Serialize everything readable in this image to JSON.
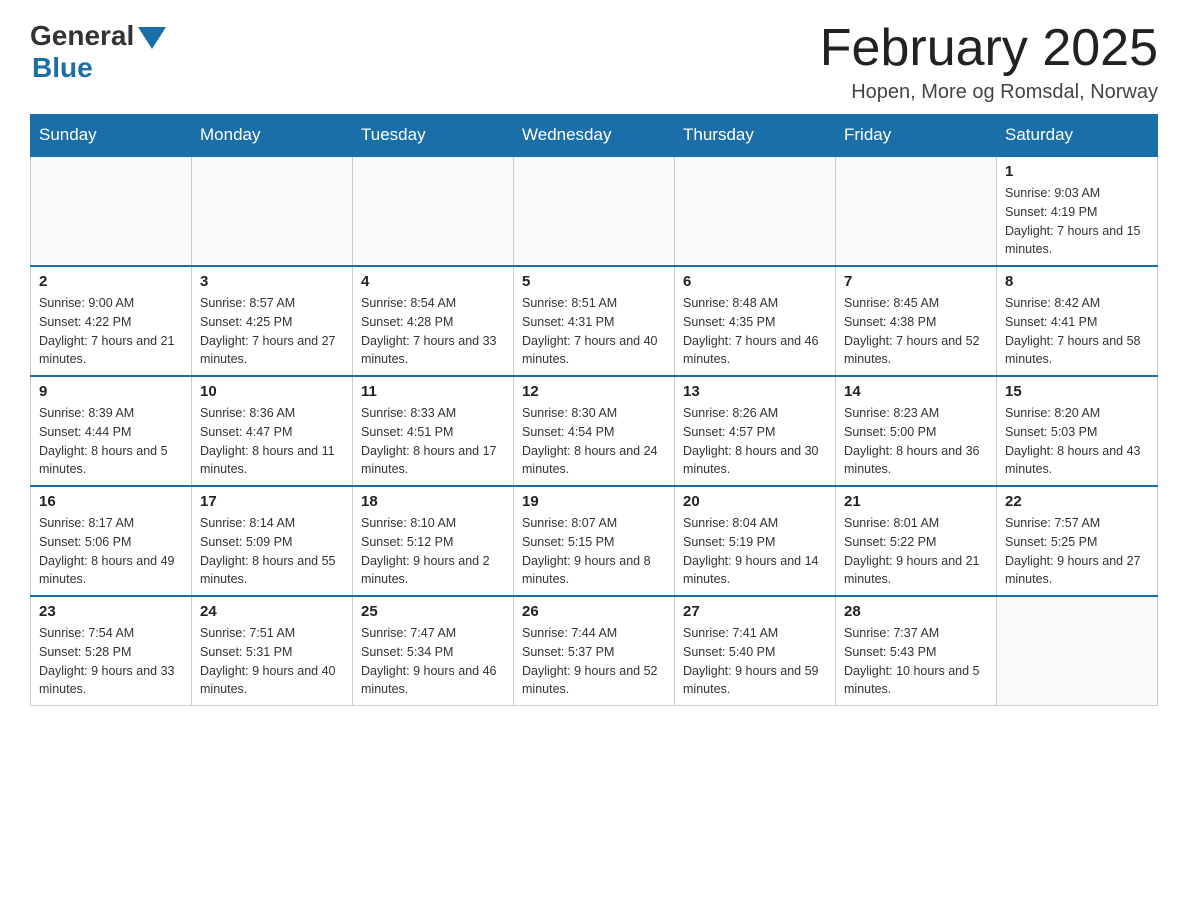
{
  "header": {
    "logo_general": "General",
    "logo_blue": "Blue",
    "month_title": "February 2025",
    "location": "Hopen, More og Romsdal, Norway"
  },
  "days_of_week": [
    "Sunday",
    "Monday",
    "Tuesday",
    "Wednesday",
    "Thursday",
    "Friday",
    "Saturday"
  ],
  "weeks": [
    [
      {
        "day": "",
        "info": ""
      },
      {
        "day": "",
        "info": ""
      },
      {
        "day": "",
        "info": ""
      },
      {
        "day": "",
        "info": ""
      },
      {
        "day": "",
        "info": ""
      },
      {
        "day": "",
        "info": ""
      },
      {
        "day": "1",
        "info": "Sunrise: 9:03 AM\nSunset: 4:19 PM\nDaylight: 7 hours and 15 minutes."
      }
    ],
    [
      {
        "day": "2",
        "info": "Sunrise: 9:00 AM\nSunset: 4:22 PM\nDaylight: 7 hours and 21 minutes."
      },
      {
        "day": "3",
        "info": "Sunrise: 8:57 AM\nSunset: 4:25 PM\nDaylight: 7 hours and 27 minutes."
      },
      {
        "day": "4",
        "info": "Sunrise: 8:54 AM\nSunset: 4:28 PM\nDaylight: 7 hours and 33 minutes."
      },
      {
        "day": "5",
        "info": "Sunrise: 8:51 AM\nSunset: 4:31 PM\nDaylight: 7 hours and 40 minutes."
      },
      {
        "day": "6",
        "info": "Sunrise: 8:48 AM\nSunset: 4:35 PM\nDaylight: 7 hours and 46 minutes."
      },
      {
        "day": "7",
        "info": "Sunrise: 8:45 AM\nSunset: 4:38 PM\nDaylight: 7 hours and 52 minutes."
      },
      {
        "day": "8",
        "info": "Sunrise: 8:42 AM\nSunset: 4:41 PM\nDaylight: 7 hours and 58 minutes."
      }
    ],
    [
      {
        "day": "9",
        "info": "Sunrise: 8:39 AM\nSunset: 4:44 PM\nDaylight: 8 hours and 5 minutes."
      },
      {
        "day": "10",
        "info": "Sunrise: 8:36 AM\nSunset: 4:47 PM\nDaylight: 8 hours and 11 minutes."
      },
      {
        "day": "11",
        "info": "Sunrise: 8:33 AM\nSunset: 4:51 PM\nDaylight: 8 hours and 17 minutes."
      },
      {
        "day": "12",
        "info": "Sunrise: 8:30 AM\nSunset: 4:54 PM\nDaylight: 8 hours and 24 minutes."
      },
      {
        "day": "13",
        "info": "Sunrise: 8:26 AM\nSunset: 4:57 PM\nDaylight: 8 hours and 30 minutes."
      },
      {
        "day": "14",
        "info": "Sunrise: 8:23 AM\nSunset: 5:00 PM\nDaylight: 8 hours and 36 minutes."
      },
      {
        "day": "15",
        "info": "Sunrise: 8:20 AM\nSunset: 5:03 PM\nDaylight: 8 hours and 43 minutes."
      }
    ],
    [
      {
        "day": "16",
        "info": "Sunrise: 8:17 AM\nSunset: 5:06 PM\nDaylight: 8 hours and 49 minutes."
      },
      {
        "day": "17",
        "info": "Sunrise: 8:14 AM\nSunset: 5:09 PM\nDaylight: 8 hours and 55 minutes."
      },
      {
        "day": "18",
        "info": "Sunrise: 8:10 AM\nSunset: 5:12 PM\nDaylight: 9 hours and 2 minutes."
      },
      {
        "day": "19",
        "info": "Sunrise: 8:07 AM\nSunset: 5:15 PM\nDaylight: 9 hours and 8 minutes."
      },
      {
        "day": "20",
        "info": "Sunrise: 8:04 AM\nSunset: 5:19 PM\nDaylight: 9 hours and 14 minutes."
      },
      {
        "day": "21",
        "info": "Sunrise: 8:01 AM\nSunset: 5:22 PM\nDaylight: 9 hours and 21 minutes."
      },
      {
        "day": "22",
        "info": "Sunrise: 7:57 AM\nSunset: 5:25 PM\nDaylight: 9 hours and 27 minutes."
      }
    ],
    [
      {
        "day": "23",
        "info": "Sunrise: 7:54 AM\nSunset: 5:28 PM\nDaylight: 9 hours and 33 minutes."
      },
      {
        "day": "24",
        "info": "Sunrise: 7:51 AM\nSunset: 5:31 PM\nDaylight: 9 hours and 40 minutes."
      },
      {
        "day": "25",
        "info": "Sunrise: 7:47 AM\nSunset: 5:34 PM\nDaylight: 9 hours and 46 minutes."
      },
      {
        "day": "26",
        "info": "Sunrise: 7:44 AM\nSunset: 5:37 PM\nDaylight: 9 hours and 52 minutes."
      },
      {
        "day": "27",
        "info": "Sunrise: 7:41 AM\nSunset: 5:40 PM\nDaylight: 9 hours and 59 minutes."
      },
      {
        "day": "28",
        "info": "Sunrise: 7:37 AM\nSunset: 5:43 PM\nDaylight: 10 hours and 5 minutes."
      },
      {
        "day": "",
        "info": ""
      }
    ]
  ]
}
